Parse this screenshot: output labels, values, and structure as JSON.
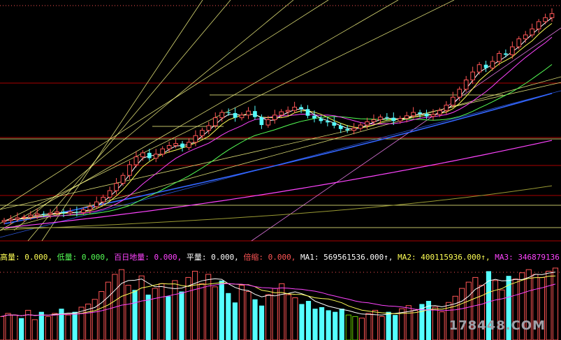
{
  "legend": [
    {
      "label": "高量",
      "value": "0.000",
      "color": "#ffff55"
    },
    {
      "label": "低量",
      "value": "0.000",
      "color": "#55ff55"
    },
    {
      "label": "百日地量",
      "value": "0.000",
      "color": "#ff44ff"
    },
    {
      "label": "平量",
      "value": "0.000",
      "color": "#ffffff"
    },
    {
      "label": "倍缩",
      "value": "0.000",
      "color": "#ff5555"
    },
    {
      "label": "MA1",
      "value": "569561536.000",
      "arrow": "↑",
      "color": "#ffffff"
    },
    {
      "label": "MA2",
      "value": "400115936.000",
      "arrow": "↑",
      "color": "#ffff55"
    },
    {
      "label": "MA3",
      "value": "346879136.000",
      "arrow": "↓",
      "color": "#ff44ff"
    }
  ],
  "watermark": "178448.COM",
  "colors": {
    "background": "#000000",
    "up": "#ff5555",
    "down": "#55ffff",
    "volume_low": "#66cc00",
    "ma_short": "#ffffff",
    "ma_mid": "#ffff55",
    "ma_long": "#ff44ff",
    "ma_green": "#55ff55",
    "ma_blue": "#3366ff",
    "ma_olive": "#999933",
    "grid": "#aa0000"
  },
  "chart_data": {
    "type": "candlestick",
    "price_panel": {
      "closes": [
        10.0,
        10.2,
        10.4,
        10.5,
        10.8,
        11.0,
        10.9,
        11.1,
        11.3,
        11.1,
        11.3,
        11.2,
        11.6,
        12.1,
        12.8,
        13.5,
        14.5,
        15.6,
        16.8,
        18.4,
        19.6,
        20.2,
        19.4,
        20.0,
        20.8,
        21.3,
        21.6,
        21.0,
        21.8,
        22.8,
        23.6,
        24.3,
        25.5,
        26.3,
        26.2,
        25.5,
        25.9,
        26.5,
        25.6,
        24.4,
        25.2,
        25.9,
        26.4,
        26.6,
        27.1,
        26.8,
        25.8,
        25.4,
        25.0,
        24.8,
        24.3,
        23.8,
        23.6,
        23.9,
        24.4,
        24.9,
        25.2,
        25.6,
        25.5,
        25.0,
        25.4,
        25.8,
        26.3,
        26.1,
        25.7,
        26.0,
        26.6,
        27.4,
        28.6,
        29.8,
        31.2,
        32.4,
        33.5,
        33.0,
        34.0,
        35.2,
        35.0,
        36.2,
        37.4,
        38.0,
        38.9,
        40.0,
        40.6,
        41.2
      ],
      "overlay_lines": [
        "MA5",
        "MA10",
        "MA20",
        "MA30",
        "MA60",
        "MA120",
        "MA250",
        "trend/gann lines"
      ]
    },
    "volume_panel": {
      "volumes": [
        30,
        34,
        32,
        28,
        38,
        26,
        36,
        30,
        34,
        40,
        32,
        36,
        42,
        46,
        52,
        62,
        74,
        84,
        90,
        70,
        64,
        82,
        58,
        66,
        72,
        56,
        76,
        62,
        80,
        88,
        72,
        84,
        68,
        76,
        60,
        48,
        70,
        62,
        52,
        44,
        58,
        66,
        72,
        58,
        54,
        46,
        50,
        40,
        42,
        38,
        36,
        40,
        32,
        30,
        28,
        34,
        38,
        30,
        36,
        32,
        40,
        44,
        38,
        46,
        50,
        42,
        36,
        48,
        56,
        66,
        74,
        80,
        70,
        88,
        76,
        64,
        82,
        78,
        86,
        90,
        84,
        80,
        88,
        92
      ],
      "colors": [
        "up",
        "up",
        "up",
        "down",
        "up",
        "up",
        "down",
        "up",
        "up",
        "down",
        "up",
        "down",
        "up",
        "up",
        "up",
        "up",
        "up",
        "up",
        "up",
        "up",
        "down",
        "up",
        "down",
        "up",
        "up",
        "down",
        "up",
        "down",
        "up",
        "up",
        "up",
        "up",
        "up",
        "down",
        "down",
        "down",
        "up",
        "up",
        "down",
        "down",
        "up",
        "up",
        "up",
        "up",
        "up",
        "down",
        "down",
        "down",
        "down",
        "down",
        "down",
        "down",
        "low",
        "low",
        "up",
        "up",
        "up",
        "up",
        "down",
        "down",
        "up",
        "up",
        "up",
        "down",
        "down",
        "up",
        "up",
        "up",
        "up",
        "up",
        "up",
        "up",
        "up",
        "down",
        "up",
        "up",
        "down",
        "up",
        "up",
        "up",
        "up",
        "up",
        "up",
        "up"
      ],
      "ma_lines": [
        "MA1",
        "MA2",
        "MA3"
      ]
    }
  }
}
